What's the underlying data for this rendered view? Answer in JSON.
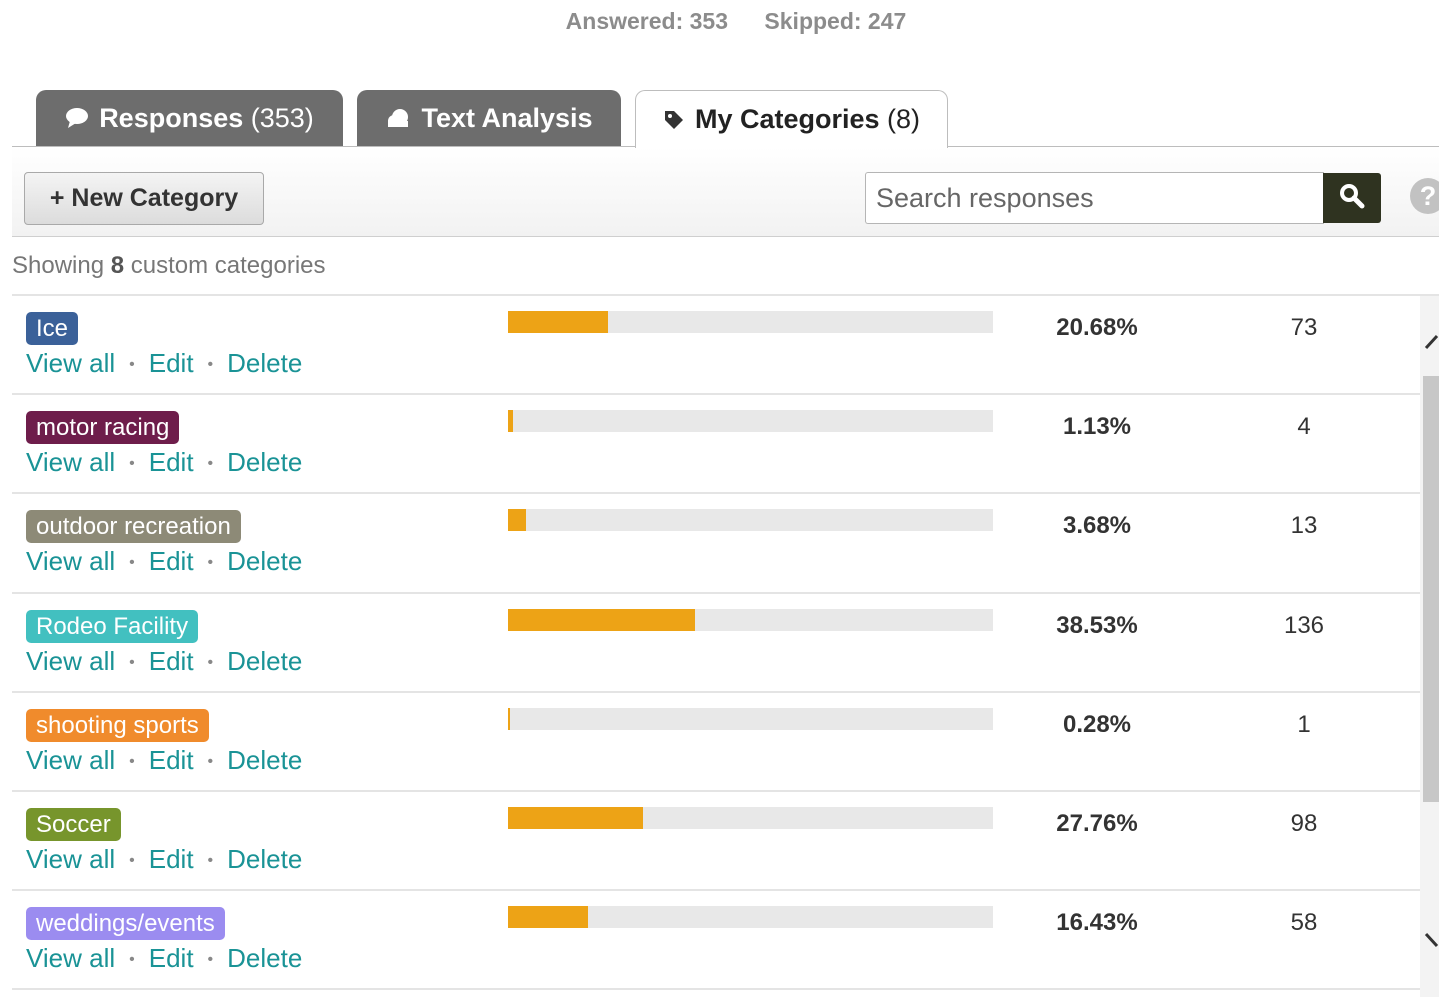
{
  "stats": {
    "answered": "Answered: 353",
    "skipped": "Skipped: 247"
  },
  "tabs": [
    {
      "label": "Responses",
      "count": "(353)",
      "icon": "speech-bubble-icon"
    },
    {
      "label": "Text Analysis",
      "count": "",
      "icon": "cloud-icon"
    },
    {
      "label": "My Categories",
      "count": "(8)",
      "icon": "tag-icon"
    }
  ],
  "toolbar": {
    "new_category_label": "+ New Category",
    "search_placeholder": "Search responses",
    "search_icon": "magnifier-icon",
    "help_label": "?"
  },
  "summary": {
    "prefix": "Showing",
    "count": "8",
    "suffix": "custom categories"
  },
  "row_actions": {
    "view_all": "View all",
    "edit": "Edit",
    "delete": "Delete",
    "separator": "•"
  },
  "categories": [
    {
      "name": "Ice",
      "color": "#3b6199",
      "percent": "20.68%",
      "count": "73",
      "fraction": 0.2068
    },
    {
      "name": "motor racing",
      "color": "#6e1d4b",
      "percent": "1.13%",
      "count": "4",
      "fraction": 0.0113
    },
    {
      "name": "outdoor recreation",
      "color": "#8d8a77",
      "percent": "3.68%",
      "count": "13",
      "fraction": 0.0368
    },
    {
      "name": "Rodeo Facility",
      "color": "#42c0c0",
      "percent": "38.53%",
      "count": "136",
      "fraction": 0.3853
    },
    {
      "name": "shooting sports",
      "color": "#f08b2c",
      "percent": "0.28%",
      "count": "1",
      "fraction": 0.0028
    },
    {
      "name": "Soccer",
      "color": "#77952c",
      "percent": "27.76%",
      "count": "98",
      "fraction": 0.2776
    },
    {
      "name": "weddings/events",
      "color": "#9b8cf0",
      "percent": "16.43%",
      "count": "58",
      "fraction": 0.1643
    }
  ],
  "colors": {
    "bar_fill": "#eda316",
    "bar_track": "#e8e8e8",
    "link": "#1a9396",
    "tab_inactive": "#6d6d6d",
    "search_button": "#2f3320"
  }
}
